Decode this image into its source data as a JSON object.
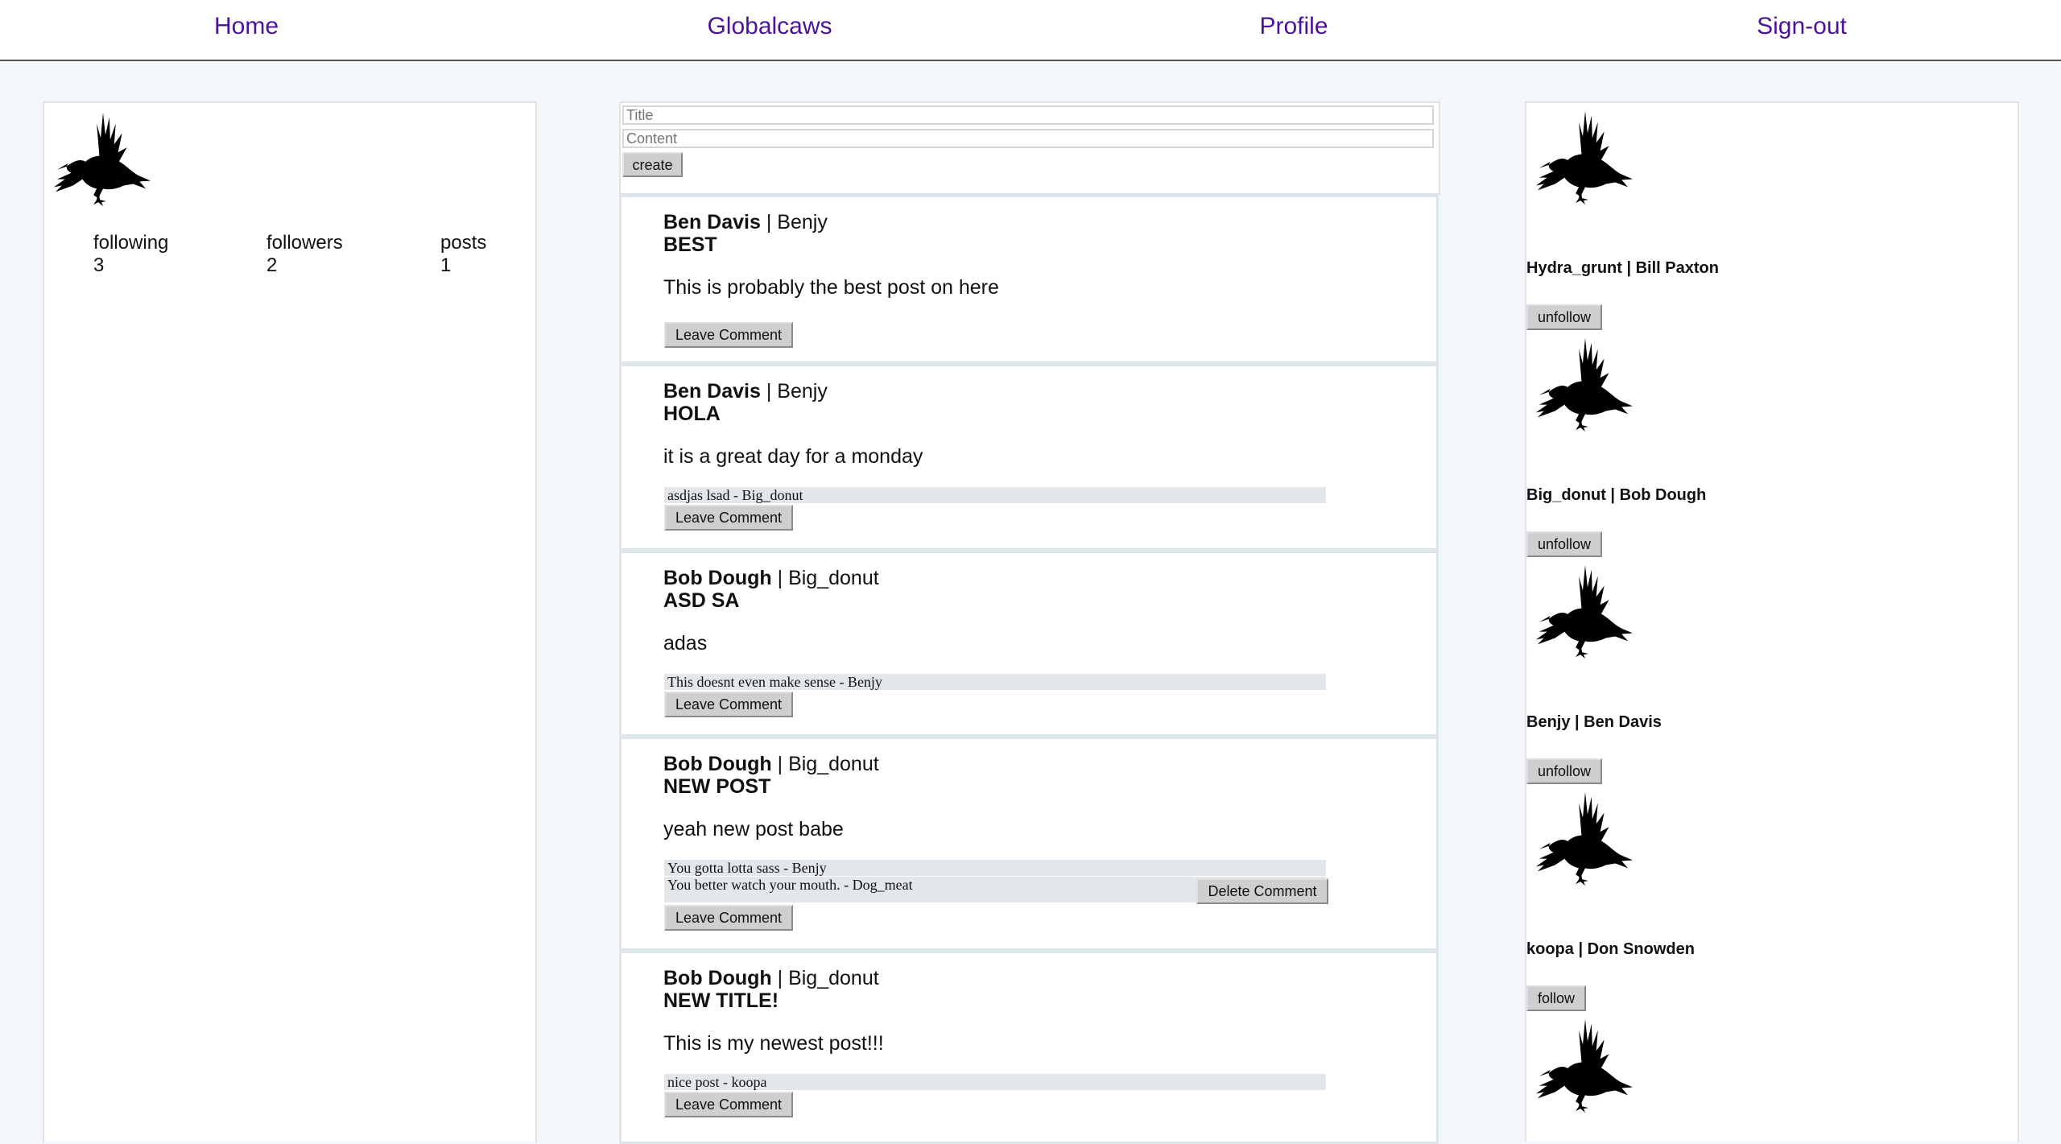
{
  "nav": {
    "home": "Home",
    "brand": "Globalcaws",
    "profile": "Profile",
    "signout": "Sign-out"
  },
  "profile_card": {
    "icon": "crow-icon",
    "following_label": "following",
    "following_count": "3",
    "followers_label": "followers",
    "followers_count": "2",
    "posts_label": "posts",
    "posts_count": "1"
  },
  "create_form": {
    "title_placeholder": "Title",
    "content_placeholder": "Content",
    "create_label": "create"
  },
  "posts": [
    {
      "name": "Ben Davis",
      "username": "| Benjy",
      "title": "BEST",
      "body": "This is probably the best post on here",
      "comments": [],
      "leave_comment": "Leave Comment"
    },
    {
      "name": "Ben Davis",
      "username": "| Benjy",
      "title": "HOLA",
      "body": "it is a great day for a monday",
      "comments": [
        {
          "text": "asdjas lsad - Big_donut"
        }
      ],
      "leave_comment": "Leave Comment"
    },
    {
      "name": "Bob Dough",
      "username": "| Big_donut",
      "title": "ASD SA",
      "body": "adas",
      "comments": [
        {
          "text": "This doesnt even make sense - Benjy"
        }
      ],
      "leave_comment": "Leave Comment"
    },
    {
      "name": "Bob Dough",
      "username": "| Big_donut",
      "title": "NEW POST",
      "body": "yeah new post babe",
      "comments": [
        {
          "text": "You gotta lotta sass - Benjy"
        },
        {
          "text": "You better watch your mouth. - Dog_meat",
          "delete_label": "Delete Comment"
        }
      ],
      "leave_comment": "Leave Comment"
    },
    {
      "name": "Bob Dough",
      "username": "| Big_donut",
      "title": "NEW TITLE!",
      "body": "This is my newest post!!!",
      "comments": [
        {
          "text": "nice post - koopa"
        }
      ],
      "leave_comment": "Leave Comment"
    }
  ],
  "follow_list": [
    {
      "label": "Hydra_grunt | Bill Paxton",
      "button": "unfollow"
    },
    {
      "label": "Big_donut | Bob Dough",
      "button": "unfollow"
    },
    {
      "label": "Benjy | Ben Davis",
      "button": "unfollow"
    },
    {
      "label": "koopa | Don Snowden",
      "button": "follow"
    }
  ]
}
